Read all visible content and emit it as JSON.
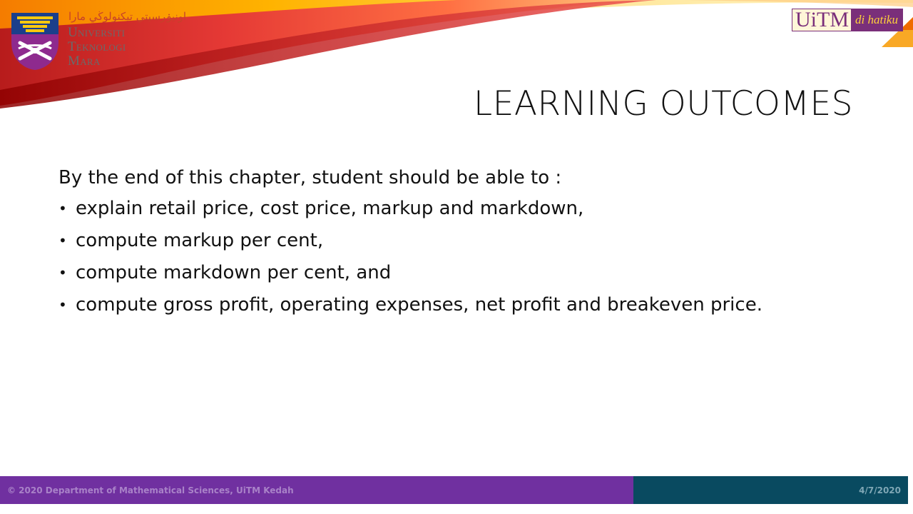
{
  "header": {
    "logo": {
      "jawi_text": "اونيۏرسيتي تيكنولوڬي مارا",
      "name_lines": [
        "Universiti",
        "Teknologi",
        "Mara"
      ]
    },
    "tagline": {
      "brand": "UiTM",
      "phrase": "di hatiku"
    }
  },
  "slide": {
    "title": "Learning Outcomes",
    "intro": "By the end of this chapter, student should be able to :",
    "bullet_glyph": "•",
    "bullets": [
      "explain retail price, cost price, markup and markdown,",
      "compute markup per cent,",
      "compute markdown per cent, and",
      "compute gross profit, operating expenses, net profit and breakeven price."
    ]
  },
  "footer": {
    "copyright": "© 2020 Department of Mathematical Sciences, UiTM Kedah",
    "date": "4/7/2020"
  },
  "colors": {
    "footer_purple": "#7030a0",
    "footer_teal": "#094a60",
    "brand_purple": "#7a2f7a",
    "swoosh_red": "#d8231f",
    "swoosh_orange": "#f5a623",
    "swoosh_yellow": "#fdd835"
  }
}
